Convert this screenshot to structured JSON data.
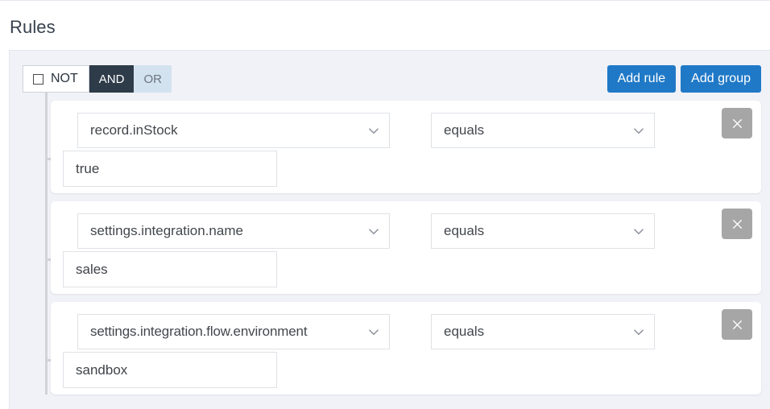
{
  "page": {
    "title": "Rules"
  },
  "group": {
    "not_label": "NOT",
    "and_label": "AND",
    "or_label": "OR",
    "not_checked": false,
    "active_conjunction": "AND",
    "add_rule_label": "Add rule",
    "add_group_label": "Add group"
  },
  "colors": {
    "accent_blue": "#2079c7",
    "conjunction_active_bg": "#2e3b49",
    "conjunction_inactive_bg": "#d3e2ef",
    "delete_button_bg": "#a6a6a6",
    "panel_bg": "#f1f2f7",
    "card_bg": "#ffffff",
    "tree_line": "#d1d3d8"
  },
  "icons": {
    "chevron_down": "chevron-down-icon",
    "close": "close-icon",
    "checkbox": "checkbox-icon"
  },
  "rules": [
    {
      "field": "record.inStock",
      "operator": "equals",
      "value": "true",
      "value_placeholder": "",
      "delete_label": "×"
    },
    {
      "field": "settings.integration.name",
      "operator": "equals",
      "value": "sales",
      "value_placeholder": "",
      "delete_label": "×"
    },
    {
      "field": "settings.integration.flow.environment",
      "operator": "equals",
      "value": "sandbox",
      "value_placeholder": "",
      "delete_label": "×"
    }
  ]
}
